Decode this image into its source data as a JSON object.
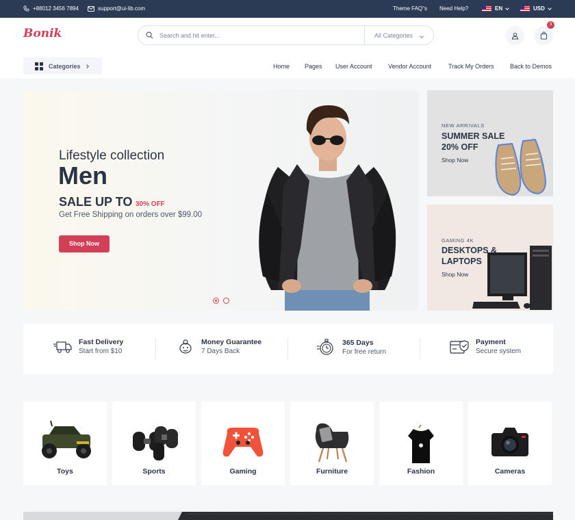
{
  "topbar": {
    "phone": "+88012 3456 7894",
    "email": "support@ui-lib.com",
    "faq": "Theme FAQ\"s",
    "help": "Need Help?",
    "language": "EN",
    "currency": "USD"
  },
  "header": {
    "logo": "Bonik",
    "search_placeholder": "Search and hit enter...",
    "category_select": "All Categories",
    "cart_count": "3",
    "categories_button": "Categories",
    "nav": [
      "Home",
      "Pages",
      "User Account",
      "Vendor Account",
      "Track My Orders",
      "Back to Demos"
    ]
  },
  "hero": {
    "subtitle": "Lifestyle collection",
    "title": "Men",
    "sale": "SALE UP TO",
    "sale_pct": "30% OFF",
    "shipping": "Get Free Shipping on orders over $99.00",
    "button": "Shop Now"
  },
  "promos": [
    {
      "kicker": "NEW ARRIVALS",
      "title": "SUMMER SALE 20% OFF",
      "link": "Shop Now"
    },
    {
      "kicker": "GAMING 4K",
      "title": "DESKTOPS & LAPTOPS",
      "link": "Shop Now"
    }
  ],
  "services": [
    {
      "title": "Fast Delivery",
      "desc": "Start from $10",
      "icon": "truck-icon"
    },
    {
      "title": "Money Guarantee",
      "desc": "7 Days Back",
      "icon": "piggy-bank-icon"
    },
    {
      "title": "365 Days",
      "desc": "For free return",
      "icon": "stopwatch-icon"
    },
    {
      "title": "Payment",
      "desc": "Secure system",
      "icon": "secure-payment-icon"
    }
  ],
  "categories": [
    "Toys",
    "Sports",
    "Gaming",
    "Furniture",
    "Fashion",
    "Cameras"
  ],
  "colors": {
    "accent": "#d23f57",
    "topbar": "#2b3a55",
    "text": "#2b3445"
  }
}
